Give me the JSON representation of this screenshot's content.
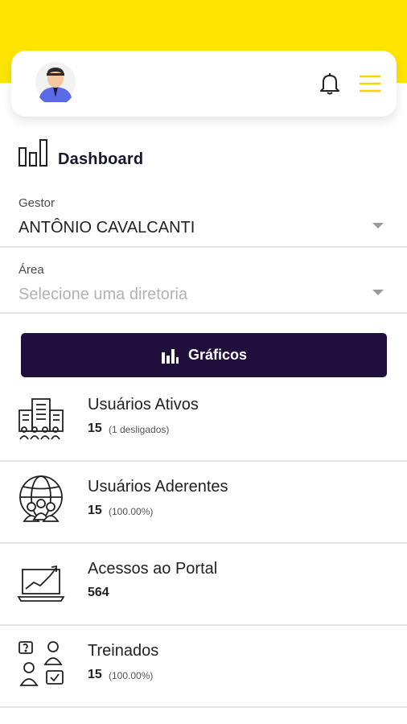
{
  "header": {
    "avatar_icon": "user-avatar-icon",
    "notification_icon": "bell-icon",
    "menu_icon": "hamburger-menu-icon",
    "brand_color": "#fee400"
  },
  "dashboard": {
    "title": "Dashboard",
    "icon": "bar-chart-outline-icon"
  },
  "filters": {
    "gestor_label": "Gestor",
    "gestor_value": "ANTÔNIO CAVALCANTI",
    "area_label": "Área",
    "area_placeholder": "Selecione uma diretoria"
  },
  "graficos_button": {
    "label": "Gráficos",
    "icon": "bar-chart-icon",
    "color": "#1f0f3d"
  },
  "stats": [
    {
      "title": "Usuários Ativos",
      "value": "15",
      "detail": "(1 desligados)",
      "icon": "office-building-people-icon"
    },
    {
      "title": "Usuários Aderentes",
      "value": "15",
      "detail": "(100.00%)",
      "icon": "globe-people-icon"
    },
    {
      "title": "Acessos ao Portal",
      "value": "564",
      "detail": "",
      "icon": "laptop-trend-chart-icon"
    },
    {
      "title": "Treinados",
      "value": "15",
      "detail": "(100.00%)",
      "icon": "training-people-icon"
    }
  ]
}
